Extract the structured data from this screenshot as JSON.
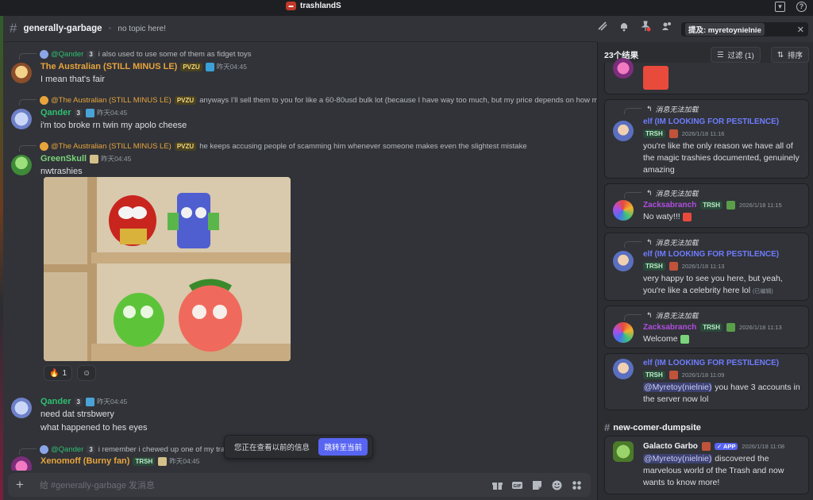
{
  "window": {
    "server_name": "trashlandS"
  },
  "channel": {
    "name": "generally-garbage",
    "topic": "no topic here!"
  },
  "search": {
    "query": "提及: myretoynielnie"
  },
  "messages": [
    {
      "reply_name": "@Qander",
      "reply_tag": "3",
      "reply_text": "i also used to use some of them as fidget toys",
      "author": "The Australian (STILL MINUS LE)",
      "author_color": "#e8a43c",
      "tag": "PVZU",
      "time": "昨天04:45",
      "text": "I mean that's fair"
    },
    {
      "reply_name": "@The Australian (STILL MINUS LE)",
      "reply_tag": "PVZU",
      "reply_text": "anyways I'll sell them to you for like a 60-80usd bulk lot (because I have way too much, but my price depends on how m...",
      "author": "Qander",
      "author_color": "#2fbf71",
      "tag": "3",
      "time": "昨天04:45",
      "text": "i'm too broke rn twin my apolo cheese"
    },
    {
      "reply_name": "@The Australian (STILL MINUS LE)",
      "reply_tag": "PVZU",
      "reply_text": "he keeps accusing people of scamming him whenever someone makes even the slightest mistake",
      "author": "GreenSkull",
      "author_color": "#7bd37b",
      "time": "昨天04:45",
      "text": "nwtrashies"
    },
    {
      "author": "Qander",
      "author_color": "#2fbf71",
      "tag": "3",
      "time": "昨天04:45",
      "text": "need dat strsbwery",
      "text2": "what happened to hes eyes"
    },
    {
      "reply_name": "@Qander",
      "reply_tag": "3",
      "reply_text": "i remember i chewed up one of my tra",
      "author": "Xenomoff (Burny fan)",
      "author_color": "#e8a43c",
      "tag": "TRSH",
      "time": "昨天04:45"
    }
  ],
  "reactions": [
    {
      "emoji": "🔥",
      "count": "1"
    }
  ],
  "jump": {
    "text": "您正在查看以前的信息",
    "button": "跳转至当前"
  },
  "composer": {
    "placeholder": "给 #generally-garbage 发消息"
  },
  "results": {
    "count": "23个结果",
    "filter_label": "过滤 (1)",
    "sort_label": "排序",
    "unloaded": "消息无法加载",
    "cards": [
      {
        "author": "elf (IM LOOKING FOR PESTILENCE)",
        "author_color": "#6f7dff",
        "tag": "TRSH",
        "time": "2026/1/18 11:16",
        "text": "you're like the only reason we have all of the magic trashies documented, genuinely amazing"
      },
      {
        "author": "Zacksabranch",
        "author_color": "#b04ee0",
        "tag": "TRSH",
        "time": "2026/1/18 11:15",
        "text": "No waty!!!"
      },
      {
        "author": "elf (IM LOOKING FOR PESTILENCE)",
        "author_color": "#6f7dff",
        "tag": "TRSH",
        "time": "2026/1/18 11:13",
        "text": "very happy to see you here, but yeah, you're like a celebrity here lol",
        "edited": "(已编辑)"
      },
      {
        "author": "Zacksabranch",
        "author_color": "#b04ee0",
        "tag": "TRSH",
        "time": "2026/1/18 11:13",
        "text": "Welcome"
      },
      {
        "author": "elf (IM LOOKING FOR PESTILENCE)",
        "author_color": "#6f7dff",
        "tag": "TRSH",
        "time": "2026/1/18 11:09",
        "mention": "@Myretoy(nielnie)",
        "text": " you have 3 accounts in the server now lol"
      }
    ],
    "section": "new-comer-dumpsite",
    "last_card": {
      "author": "Galacto Garbo",
      "author_color": "#f2f3f5",
      "badge": "APP",
      "time": "2026/1/18 11:08",
      "mention": "@Myretoy(nielnie)",
      "text": " discovered the marvelous world of the Trash and now wants to know more!"
    }
  }
}
